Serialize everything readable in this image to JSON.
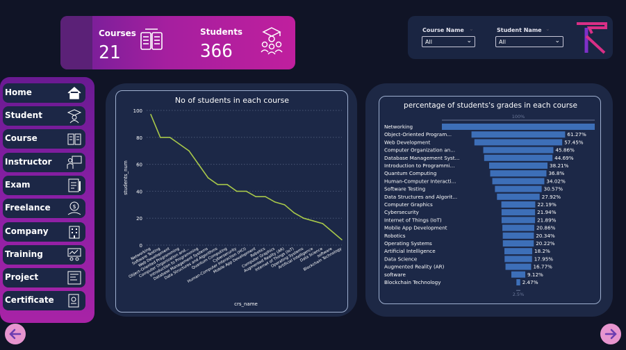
{
  "kpi": {
    "courses_label": "Courses",
    "courses_value": "21",
    "students_label": "Students",
    "students_value": "366"
  },
  "filters": {
    "course": {
      "label": "Course Name",
      "value": "All"
    },
    "student": {
      "label": "Student Name",
      "value": "All"
    }
  },
  "sidebar": {
    "items": [
      {
        "label": "Home",
        "icon": "home-icon"
      },
      {
        "label": "Student",
        "icon": "graduate-icon"
      },
      {
        "label": "Course",
        "icon": "book-icon"
      },
      {
        "label": "Instructor",
        "icon": "teacher-icon"
      },
      {
        "label": "Exam",
        "icon": "exam-icon"
      },
      {
        "label": "Freelance",
        "icon": "freelance-icon"
      },
      {
        "label": "Company",
        "icon": "building-icon"
      },
      {
        "label": "Training",
        "icon": "training-icon"
      },
      {
        "label": "Project",
        "icon": "project-icon"
      },
      {
        "label": "Certificate",
        "icon": "certificate-icon"
      }
    ]
  },
  "colors": {
    "accent": "#c01f9e",
    "line": "#a8c84a",
    "bar": "#3d6fb8"
  },
  "chart_data": [
    {
      "type": "line",
      "title": "No of students in each course",
      "xlabel": "crs_name",
      "ylabel": "students_num",
      "ylim": [
        0,
        100
      ],
      "yticks": [
        0,
        20,
        40,
        60,
        80,
        100
      ],
      "grid": true,
      "categories": [
        "Networking",
        "Software Testing",
        "Web Development",
        "Object-Oriented Programming",
        "Computer Organization and...",
        "Introduction to Programming",
        "Database Management Systems",
        "Data Structures and Algorithms",
        "Quantum Computing",
        "Cybersecurity",
        "Human-Computer Interaction (HCI)",
        "Mobile App Development",
        "Robotics",
        "Computer Graphics",
        "Augmented Reality (AR)",
        "Internet of Things (IoT)",
        "Operating Systems",
        "Artificial Intelligence",
        "Data Science",
        "software",
        "Blockchain Technology"
      ],
      "values": [
        97,
        80,
        80,
        75,
        70,
        60,
        50,
        45,
        45,
        40,
        40,
        36,
        36,
        32,
        30,
        24,
        20,
        18,
        16,
        10,
        4
      ]
    },
    {
      "type": "bar",
      "title": "percentage of students's grades in each course",
      "top_label": "100%",
      "bottom_label": "2.5%",
      "categories": [
        "Networking",
        "Object-Oriented Program...",
        "Web Development",
        "Computer Organization an...",
        "Database Management Syst...",
        "Introduction to Programmi...",
        "Quantum Computing",
        "Human-Computer Interacti...",
        "Software Testing",
        "Data Structures and Algorit...",
        "Computer Graphics",
        "Cybersecurity",
        "Internet of Things (IoT)",
        "Mobile App Development",
        "Robotics",
        "Operating Systems",
        "Artificial Intelligence",
        "Data Science",
        "Augmented Reality (AR)",
        "software",
        "Blockchain Technology"
      ],
      "values": [
        100,
        61.27,
        57.45,
        45.86,
        44.69,
        38.21,
        36.8,
        34.02,
        30.57,
        27.92,
        22.19,
        21.94,
        21.89,
        20.86,
        20.34,
        20.22,
        18.2,
        17.95,
        16.77,
        9.12,
        2.47
      ],
      "value_labels": [
        "",
        "61.27%",
        "57.45%",
        "45.86%",
        "44.69%",
        "38.21%",
        "36.8%",
        "34.02%",
        "30.57%",
        "27.92%",
        "22.19%",
        "21.94%",
        "21.89%",
        "20.86%",
        "20.34%",
        "20.22%",
        "18.2%",
        "17.95%",
        "16.77%",
        "9.12%",
        "2.47%"
      ]
    }
  ]
}
